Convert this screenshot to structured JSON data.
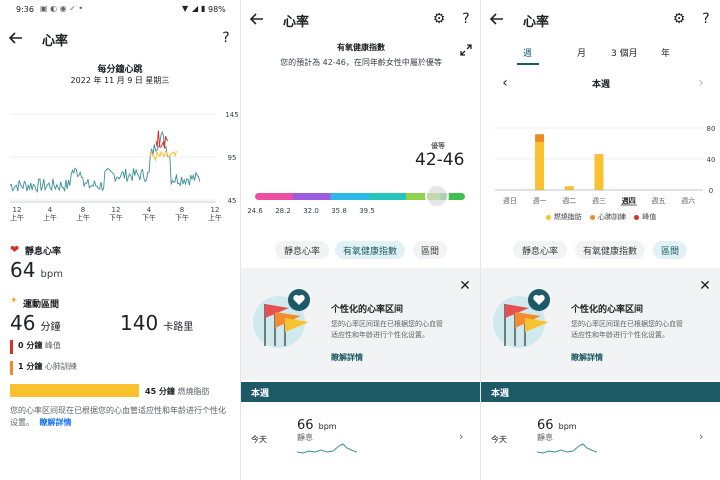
{
  "status_bar": {
    "time": "9:36",
    "battery": "98%"
  },
  "panel1": {
    "title": "心率",
    "help": "?",
    "chart_title": "每分鐘心跳",
    "chart_date": "2022 年 11 月 9 日 星期三",
    "chart_data": {
      "type": "line",
      "y_ticks": [
        "145",
        "95",
        "45"
      ],
      "x_ticks": [
        {
          "n": "12",
          "p": "上午"
        },
        {
          "n": "4",
          "p": "上午"
        },
        {
          "n": "8",
          "p": "上午"
        },
        {
          "n": "12",
          "p": "下午"
        },
        {
          "n": "4",
          "p": "下午"
        },
        {
          "n": "8",
          "p": "下午"
        },
        {
          "n": "12",
          "p": "上午"
        }
      ],
      "ylim": [
        45,
        145
      ]
    },
    "resting": {
      "label": "靜息心率",
      "value": "64",
      "unit": "bpm"
    },
    "zones": {
      "label": "運動區間",
      "minutes": "46",
      "minutes_unit": "分鐘",
      "calories": "140",
      "calories_unit": "卡路里"
    },
    "peak": {
      "value": "0 分鐘",
      "label": "峰值"
    },
    "cardio": {
      "value": "1 分鐘",
      "label": "心肺訓練"
    },
    "fatburn": {
      "value": "45 分鐘",
      "label": "燃燒脂肪",
      "fraction": 0.98
    },
    "note": "您的心率区间现在已根据您的心血管适应性和年龄进行个性化设置。",
    "link": "瞭解詳情"
  },
  "panel2": {
    "title": "心率",
    "help": "?",
    "fitness_title": "有氧健康指數",
    "fitness_desc": "您的預計為 42-46，在同年齡女性中屬於優等",
    "rating_label": "優等",
    "rating_value": "42-46",
    "scale_ticks": [
      "24.6",
      "28.2",
      "32.0",
      "35.8",
      "39.5"
    ],
    "chips": [
      "靜息心率",
      "有氧健康指數",
      "區間"
    ],
    "card": {
      "title": "个性化的心率区间",
      "body": "您的心率区间现在已根据您的心血管适应性和年龄进行个性化设置。",
      "link": "瞭解詳情"
    },
    "week_header": "本週",
    "today": {
      "label": "今天",
      "value": "66",
      "unit": "bpm",
      "sub": "靜息"
    }
  },
  "panel3": {
    "title": "心率",
    "help": "?",
    "tabs": [
      "週",
      "月",
      "3 個月",
      "年"
    ],
    "period": "本週",
    "chart_data": {
      "type": "bar",
      "categories": [
        "週日",
        "週一",
        "週二",
        "週三",
        "週四",
        "週五",
        "週六"
      ],
      "y_ticks": [
        "80",
        "40",
        "0"
      ],
      "ylim": [
        0,
        80
      ],
      "series": [
        {
          "name": "燃燒脂肪",
          "values": [
            0,
            62,
            5,
            45,
            0,
            0,
            0
          ]
        },
        {
          "name": "心肺訓練",
          "values": [
            0,
            10,
            0,
            1,
            0,
            0,
            0
          ]
        },
        {
          "name": "峰值",
          "values": [
            0,
            0,
            0,
            0,
            0,
            0,
            0
          ]
        }
      ],
      "highlight": "週四"
    },
    "chips": [
      "靜息心率",
      "有氧健康指數",
      "區間"
    ],
    "card": {
      "title": "个性化的心率区间",
      "body": "您的心率区间现在已根据您的心血管适应性和年龄进行个性化设置。",
      "link": "瞭解詳情"
    },
    "week_header": "本週",
    "today": {
      "label": "今天",
      "value": "66",
      "unit": "bpm",
      "sub": "靜息"
    }
  },
  "colors": {
    "accent": "#1a73e8",
    "teal": "#3b8f96",
    "fatburn": "#f9c12e",
    "cardio": "#f08a24",
    "peak": "#d93025",
    "header": "#1d5966"
  }
}
